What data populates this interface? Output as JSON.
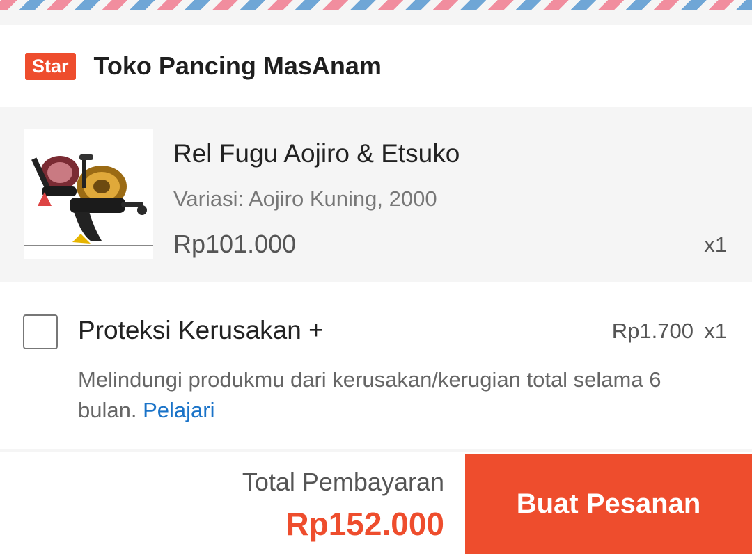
{
  "shop": {
    "badge": "Star",
    "name": "Toko Pancing MasAnam"
  },
  "product": {
    "image_icon": "fishing-reel-image",
    "title": "Rel Fugu Aojiro & Etsuko",
    "variant": "Variasi: Aojiro Kuning, 2000",
    "price": "Rp101.000",
    "quantity": "x1"
  },
  "protection": {
    "title": "Proteksi Kerusakan +",
    "price": "Rp1.700",
    "quantity": "x1",
    "description": "Melindungi produkmu dari kerusakan/kerugian total selama 6 bulan.",
    "link": "Pelajari",
    "checked": false
  },
  "checkout": {
    "total_label": "Total Pembayaran",
    "total_value": "Rp152.000",
    "order_button": "Buat Pesanan"
  },
  "colors": {
    "accent": "#ee4d2d",
    "link": "#1a73c8",
    "airmail_blue": "#6fa6d6",
    "airmail_pink": "#f18d9e"
  }
}
